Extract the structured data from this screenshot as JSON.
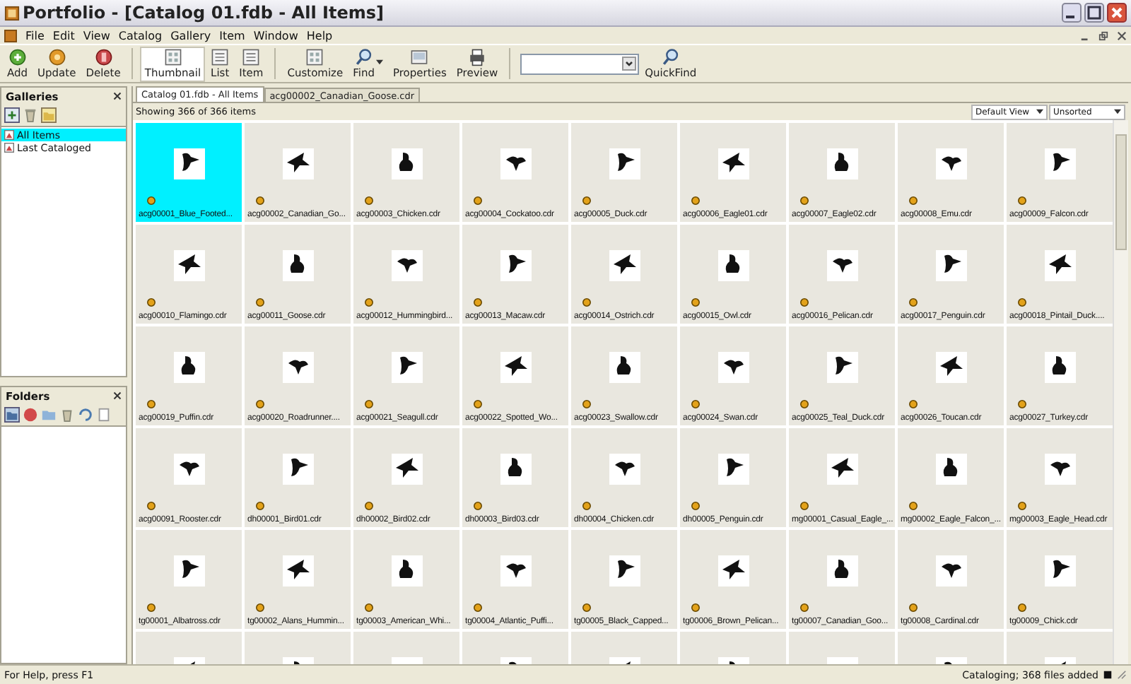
{
  "window": {
    "title": "Portfolio - [Catalog 01.fdb - All Items]"
  },
  "menu": [
    "File",
    "Edit",
    "View",
    "Catalog",
    "Gallery",
    "Item",
    "Window",
    "Help"
  ],
  "toolbar": [
    {
      "label": "Add",
      "kind": "add",
      "selected": false,
      "has_menu": false
    },
    {
      "label": "Update",
      "kind": "update",
      "selected": false,
      "has_menu": false
    },
    {
      "label": "Delete",
      "kind": "delete",
      "selected": false,
      "has_menu": false
    },
    {
      "label": "Thumbnail",
      "kind": "grid",
      "selected": true,
      "has_menu": false
    },
    {
      "label": "List",
      "kind": "list",
      "selected": false,
      "has_menu": false
    },
    {
      "label": "Item",
      "kind": "list",
      "selected": false,
      "has_menu": false
    },
    {
      "label": "Customize",
      "kind": "grid",
      "selected": false,
      "has_menu": false
    },
    {
      "label": "Find",
      "kind": "find",
      "selected": false,
      "has_menu": true
    },
    {
      "label": "Properties",
      "kind": "properties",
      "selected": false,
      "has_menu": false
    },
    {
      "label": "Preview",
      "kind": "preview",
      "selected": false,
      "has_menu": false
    }
  ],
  "quickfind": {
    "label": "QuickFind"
  },
  "galleries": {
    "title": "Galleries",
    "items": [
      {
        "label": "All Items",
        "selected": true
      },
      {
        "label": "Last Cataloged",
        "selected": false
      }
    ]
  },
  "folders": {
    "title": "Folders"
  },
  "tabs": [
    {
      "label": "Catalog 01.fdb - All Items",
      "selected": true
    },
    {
      "label": "acg00002_Canadian_Goose.cdr",
      "selected": false
    }
  ],
  "view": {
    "count": "Showing 366 of 366 items",
    "view_mode": "Default View",
    "sort": "Unsorted"
  },
  "items": [
    {
      "label": "acg00001_Blue_Footed...",
      "selected": true
    },
    {
      "label": "acg00002_Canadian_Go...",
      "selected": false
    },
    {
      "label": "acg00003_Chicken.cdr",
      "selected": false
    },
    {
      "label": "acg00004_Cockatoo.cdr",
      "selected": false
    },
    {
      "label": "acg00005_Duck.cdr",
      "selected": false
    },
    {
      "label": "acg00006_Eagle01.cdr",
      "selected": false
    },
    {
      "label": "acg00007_Eagle02.cdr",
      "selected": false
    },
    {
      "label": "acg00008_Emu.cdr",
      "selected": false
    },
    {
      "label": "acg00009_Falcon.cdr",
      "selected": false
    },
    {
      "label": "acg00010_Flamingo.cdr",
      "selected": false
    },
    {
      "label": "acg00011_Goose.cdr",
      "selected": false
    },
    {
      "label": "acg00012_Hummingbird...",
      "selected": false
    },
    {
      "label": "acg00013_Macaw.cdr",
      "selected": false
    },
    {
      "label": "acg00014_Ostrich.cdr",
      "selected": false
    },
    {
      "label": "acg00015_Owl.cdr",
      "selected": false
    },
    {
      "label": "acg00016_Pelican.cdr",
      "selected": false
    },
    {
      "label": "acg00017_Penguin.cdr",
      "selected": false
    },
    {
      "label": "acg00018_Pintail_Duck....",
      "selected": false
    },
    {
      "label": "acg00019_Puffin.cdr",
      "selected": false
    },
    {
      "label": "acg00020_Roadrunner....",
      "selected": false
    },
    {
      "label": "acg00021_Seagull.cdr",
      "selected": false
    },
    {
      "label": "acg00022_Spotted_Wo...",
      "selected": false
    },
    {
      "label": "acg00023_Swallow.cdr",
      "selected": false
    },
    {
      "label": "acg00024_Swan.cdr",
      "selected": false
    },
    {
      "label": "acg00025_Teal_Duck.cdr",
      "selected": false
    },
    {
      "label": "acg00026_Toucan.cdr",
      "selected": false
    },
    {
      "label": "acg00027_Turkey.cdr",
      "selected": false
    },
    {
      "label": "acg00091_Rooster.cdr",
      "selected": false
    },
    {
      "label": "dh00001_Bird01.cdr",
      "selected": false
    },
    {
      "label": "dh00002_Bird02.cdr",
      "selected": false
    },
    {
      "label": "dh00003_Bird03.cdr",
      "selected": false
    },
    {
      "label": "dh00004_Chicken.cdr",
      "selected": false
    },
    {
      "label": "dh00005_Penguin.cdr",
      "selected": false
    },
    {
      "label": "mg00001_Casual_Eagle_...",
      "selected": false
    },
    {
      "label": "mg00002_Eagle_Falcon_...",
      "selected": false
    },
    {
      "label": "mg00003_Eagle_Head.cdr",
      "selected": false
    },
    {
      "label": "tg00001_Albatross.cdr",
      "selected": false
    },
    {
      "label": "tg00002_Alans_Hummin...",
      "selected": false
    },
    {
      "label": "tg00003_American_Whi...",
      "selected": false
    },
    {
      "label": "tg00004_Atlantic_Puffi...",
      "selected": false
    },
    {
      "label": "tg00005_Black_Capped...",
      "selected": false
    },
    {
      "label": "tg00006_Brown_Pelican...",
      "selected": false
    },
    {
      "label": "tg00007_Canadian_Goo...",
      "selected": false
    },
    {
      "label": "tg00008_Cardinal.cdr",
      "selected": false
    },
    {
      "label": "tg00009_Chick.cdr",
      "selected": false
    },
    {
      "selected": false
    },
    {
      "selected": false
    },
    {
      "selected": false
    },
    {
      "selected": false
    },
    {
      "selected": false
    },
    {
      "selected": false
    },
    {
      "selected": false
    },
    {
      "selected": false
    },
    {
      "selected": false
    }
  ],
  "status_bar": {
    "help": "For Help, press F1",
    "progress": "Cataloging; 368 files added"
  }
}
